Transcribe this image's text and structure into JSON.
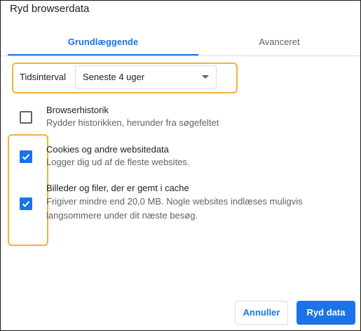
{
  "dialog": {
    "title": "Ryd browserdata"
  },
  "tabs": [
    {
      "label": "Grundlæggende",
      "active": true
    },
    {
      "label": "Avanceret",
      "active": false
    }
  ],
  "time_range": {
    "label": "Tidsinterval",
    "selected": "Seneste 4 uger"
  },
  "options": [
    {
      "title": "Browserhistorik",
      "description": "Rydder historikken, herunder fra søgefeltet",
      "checked": false
    },
    {
      "title": "Cookies og andre websitedata",
      "description": "Logger dig ud af de fleste websites.",
      "checked": true
    },
    {
      "title": "Billeder og filer, der er gemt i cache",
      "description": "Frigiver mindre end 20,0 MB. Nogle websites indlæses muligvis langsommere under dit næste besøg.",
      "checked": true
    }
  ],
  "buttons": {
    "cancel": "Annuller",
    "clear": "Ryd data"
  },
  "colors": {
    "accent": "#1a73e8",
    "highlight": "#f2b23a"
  }
}
